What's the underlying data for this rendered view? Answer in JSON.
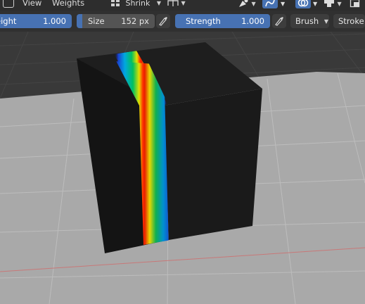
{
  "header": {
    "view_label": "View",
    "weights_label": "Weights",
    "falloff_shape": "Shrink"
  },
  "toolbar": {
    "weight": {
      "label": "eight",
      "value": "1.000"
    },
    "size": {
      "label": "Size",
      "value": "152 px"
    },
    "strength": {
      "label": "Strength",
      "value": "1.000"
    },
    "brush_label": "Brush",
    "stroke_label": "Stroke"
  },
  "colors": {
    "header_bg": "#2d2d2d",
    "toolbar_bg": "#303030",
    "accent_blue": "#4772b3",
    "cube_face": "#141414",
    "grid_plane": "#a9a9a9"
  },
  "icons": {
    "mode": "weight-paint-mode-icon",
    "falloff": "falloff-shape-icon",
    "symmetry": "mirror-axis-icon",
    "pressure": "pen-pressure-icon",
    "snap": "vertex-snap-icon",
    "overlay": "overlay-icon",
    "xray": "xray-icon",
    "gizmo": "gizmo-icon"
  }
}
